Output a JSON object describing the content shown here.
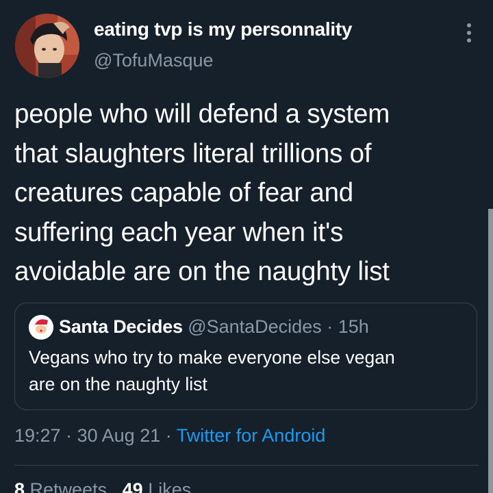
{
  "author": {
    "display_name": "eating tvp is my personnality",
    "handle": "@TofuMasque",
    "avatar_icon": "profile-photo"
  },
  "more_icon": "vertical-ellipsis-icon",
  "tweet": {
    "lines": [
      "people who will defend a system",
      "that slaughters literal trillions of",
      "creatures capable of fear and",
      "suffering each year when it's",
      "avoidable are on the naughty list"
    ]
  },
  "quote": {
    "name": "Santa Decides",
    "handle": "@SantaDecides",
    "separator": "·",
    "time": "15h",
    "avatar_icon": "santa-avatar",
    "lines": [
      "Vegans who try to make everyone else vegan",
      "are on the naughty list"
    ]
  },
  "meta": {
    "time": "19:27",
    "date": "30 Aug 21",
    "separator": "·",
    "source": "Twitter for Android"
  },
  "stats": {
    "retweets_count": "8",
    "retweets_label": "Retweets",
    "likes_count": "49",
    "likes_label": "Likes"
  },
  "colors": {
    "background": "#15202b",
    "secondary_text": "#8b98a5",
    "link": "#1d9bf0",
    "border": "#38444d"
  }
}
